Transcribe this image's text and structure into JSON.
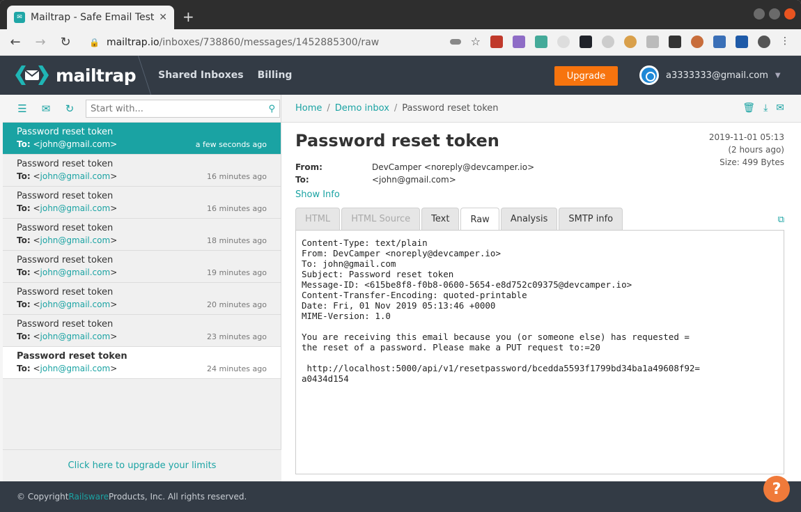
{
  "browser": {
    "tab_title": "Mailtrap - Safe Email Testi",
    "url_host": "mailtrap.io",
    "url_path": "/inboxes/738860/messages/1452885300/raw"
  },
  "app": {
    "logo_text": "mailtrap",
    "nav": [
      "Shared Inboxes",
      "Billing"
    ],
    "upgrade_label": "Upgrade",
    "user_email": "a3333333@gmail.com"
  },
  "left": {
    "search_placeholder": "Start with...",
    "messages": [
      {
        "subject": "Password reset token",
        "to_label": "To:",
        "to": "<john@gmail.com>",
        "time": "a few seconds ago",
        "state": "active"
      },
      {
        "subject": "Password reset token",
        "to_label": "To:",
        "to": "john@gmail.com",
        "time": "16 minutes ago",
        "state": "read"
      },
      {
        "subject": "Password reset token",
        "to_label": "To:",
        "to": "john@gmail.com",
        "time": "16 minutes ago",
        "state": "read"
      },
      {
        "subject": "Password reset token",
        "to_label": "To:",
        "to": "john@gmail.com",
        "time": "18 minutes ago",
        "state": "read"
      },
      {
        "subject": "Password reset token",
        "to_label": "To:",
        "to": "john@gmail.com",
        "time": "19 minutes ago",
        "state": "read"
      },
      {
        "subject": "Password reset token",
        "to_label": "To:",
        "to": "john@gmail.com",
        "time": "20 minutes ago",
        "state": "read"
      },
      {
        "subject": "Password reset token",
        "to_label": "To:",
        "to": "john@gmail.com",
        "time": "23 minutes ago",
        "state": "read"
      },
      {
        "subject": "Password reset token",
        "to_label": "To:",
        "to": "john@gmail.com",
        "time": "24 minutes ago",
        "state": "unread"
      }
    ],
    "upgrade_link": "Click here to upgrade your limits"
  },
  "right": {
    "breadcrumb": {
      "home": "Home",
      "inbox": "Demo inbox",
      "current": "Password reset token"
    },
    "title": "Password reset token",
    "date": "2019-11-01 05:13",
    "relative": "(2 hours ago)",
    "size": "Size: 499 Bytes",
    "from_label": "From:",
    "from": "DevCamper <noreply@devcamper.io>",
    "to_label": "To:",
    "to": "<john@gmail.com>",
    "show_info": "Show Info",
    "tabs": [
      "HTML",
      "HTML Source",
      "Text",
      "Raw",
      "Analysis",
      "SMTP info"
    ],
    "active_tab": "Raw",
    "raw": "Content-Type: text/plain\nFrom: DevCamper <noreply@devcamper.io>\nTo: john@gmail.com\nSubject: Password reset token\nMessage-ID: <615be8f8-f0b8-0600-5654-e8d752c09375@devcamper.io>\nContent-Transfer-Encoding: quoted-printable\nDate: Fri, 01 Nov 2019 05:13:46 +0000\nMIME-Version: 1.0\n\nYou are receiving this email because you (or someone else) has requested =\nthe reset of a password. Please make a PUT request to:=20\n\n http://localhost:5000/api/v1/resetpassword/bcedda5593f1799bd34ba1a49608f92=\na0434d154"
  },
  "footer": {
    "prefix": "© Copyright ",
    "brand": "Railsware",
    "suffix": " Products, Inc. All rights reserved."
  },
  "colors": {
    "accent": "#1aa3a3",
    "header": "#333b45",
    "upgrade": "#f7740e",
    "help": "#f07a3a"
  }
}
